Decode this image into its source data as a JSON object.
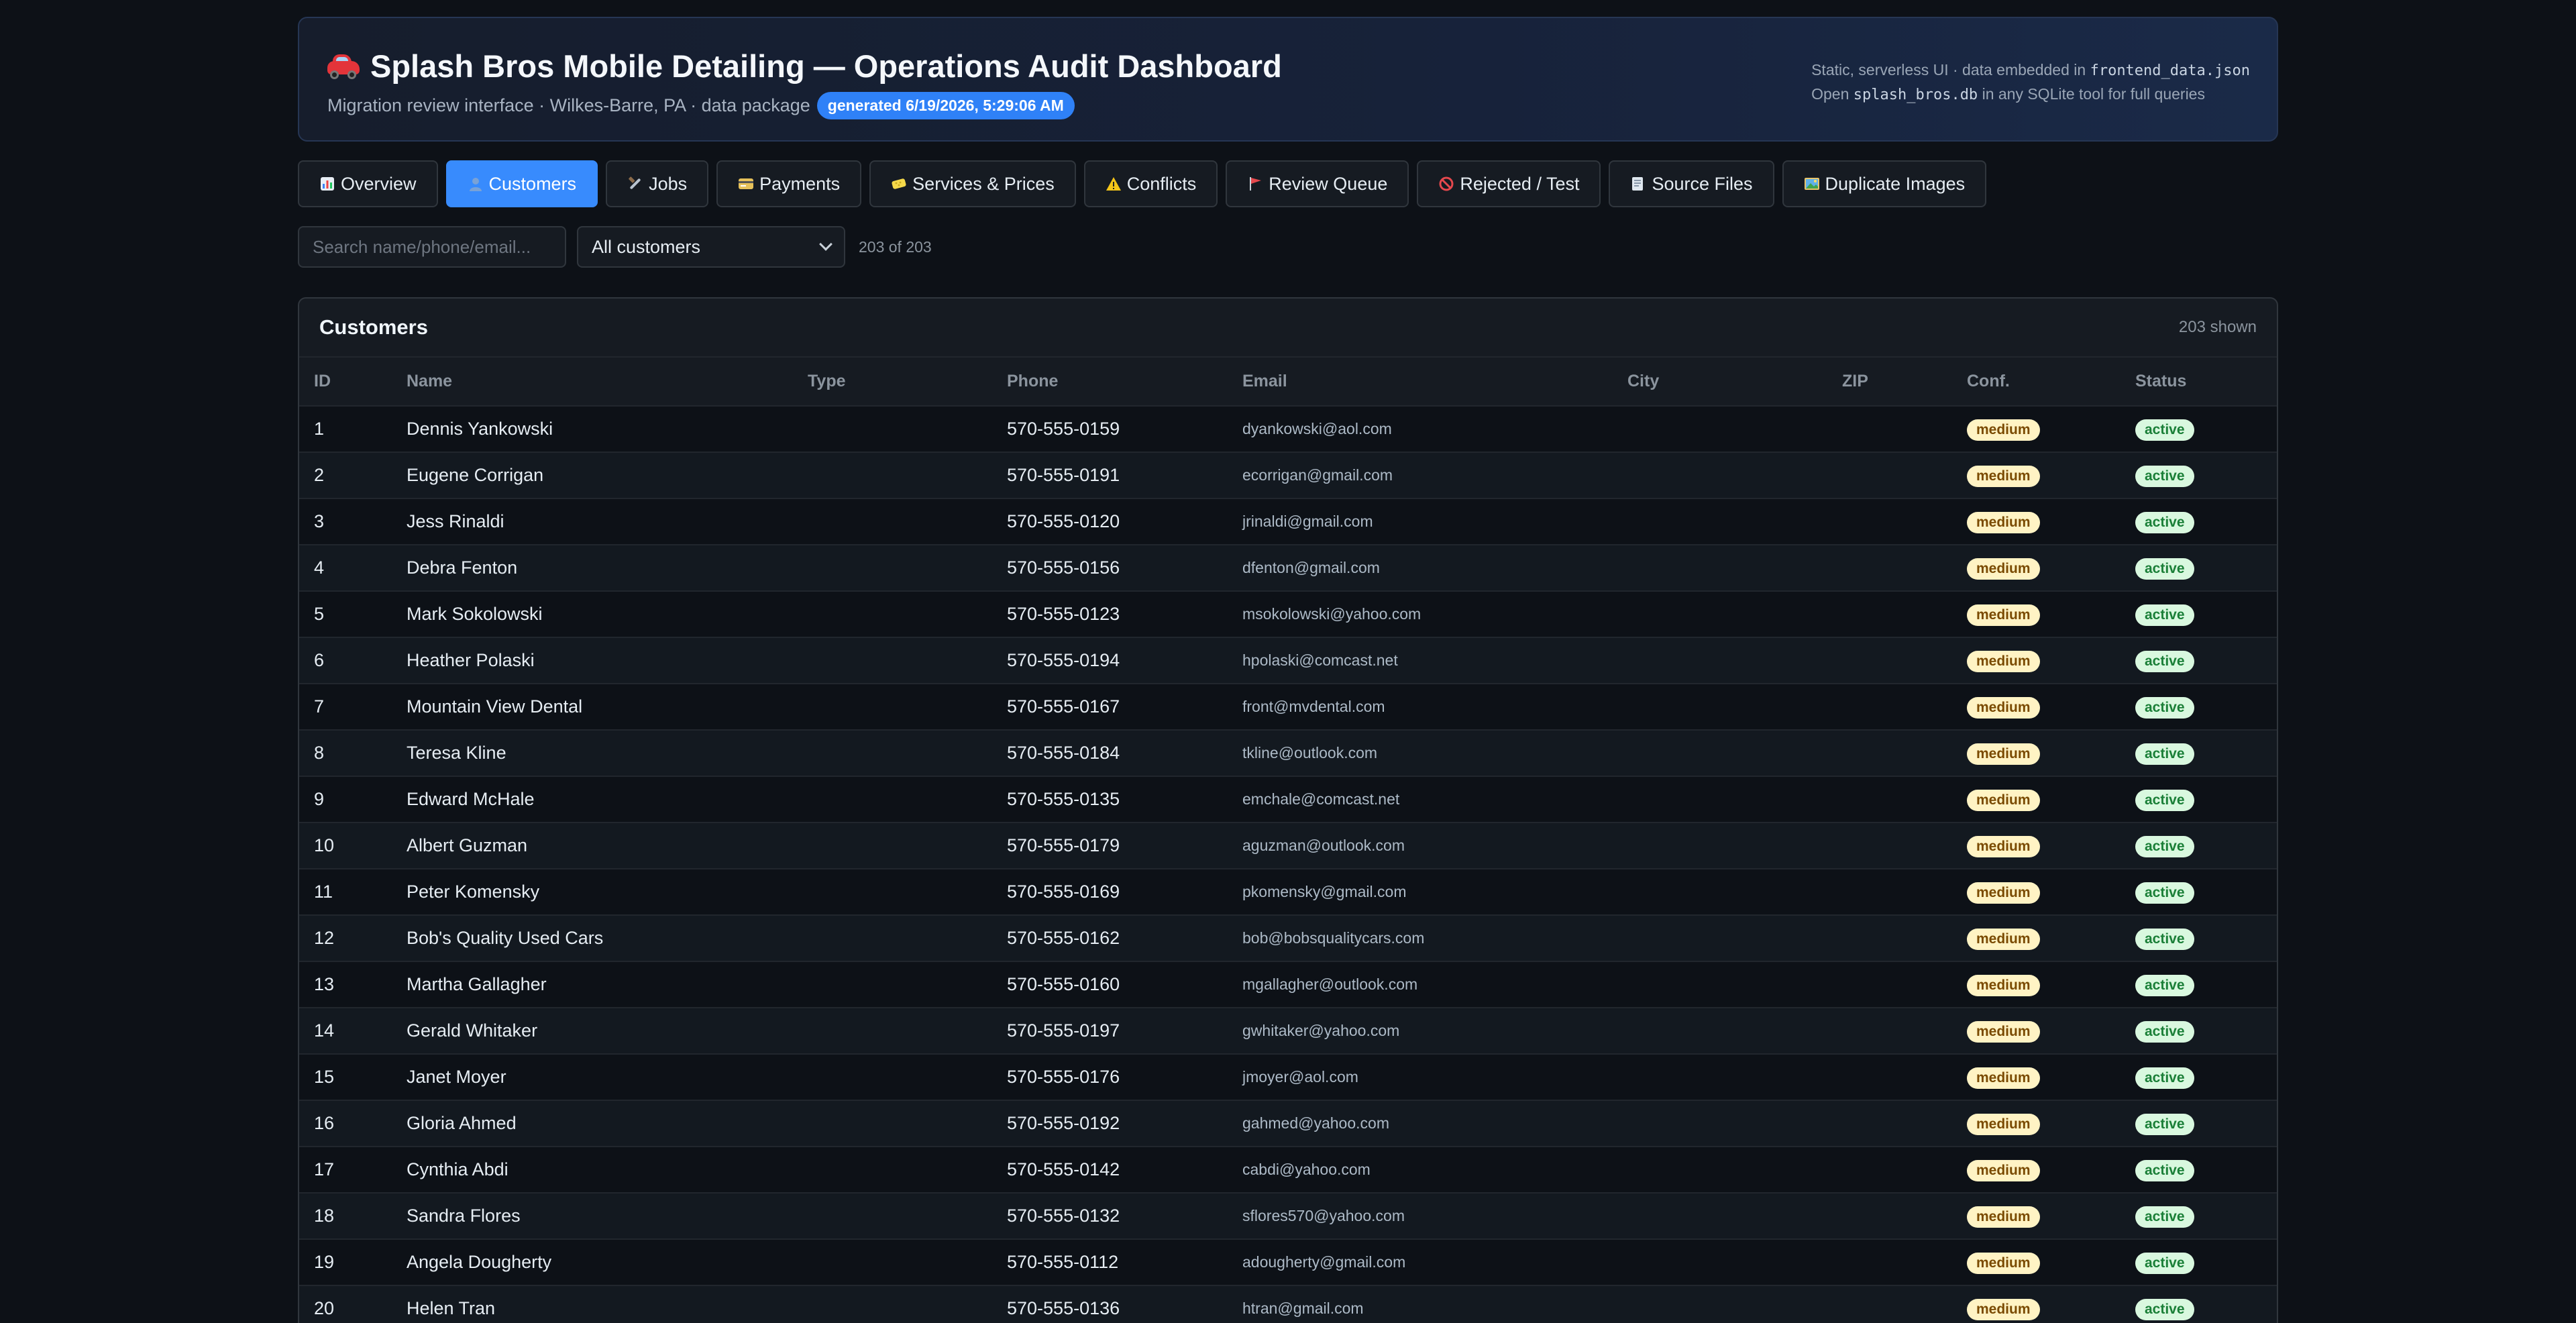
{
  "header": {
    "title": "Splash Bros Mobile Detailing — Operations Audit Dashboard",
    "subtitle": "Migration review interface · Wilkes-Barre, PA · data package",
    "generated": "generated 6/19/2026, 5:29:06 AM",
    "note_line1_prefix": "Static, serverless UI · data embedded in",
    "note_line1_code": "frontend_data.json",
    "note_line2_prefix": "Open",
    "note_line2_code": "splash_bros.db",
    "note_line2_suffix": "in any SQLite tool for full queries",
    "icon": "car-icon"
  },
  "tabs": [
    {
      "id": "overview",
      "label": "Overview",
      "icon": "chart-icon"
    },
    {
      "id": "customers",
      "label": "Customers",
      "icon": "person-icon",
      "active": true
    },
    {
      "id": "jobs",
      "label": "Jobs",
      "icon": "wrench-icon"
    },
    {
      "id": "payments",
      "label": "Payments",
      "icon": "card-icon"
    },
    {
      "id": "services",
      "label": "Services & Prices",
      "icon": "sponge-icon"
    },
    {
      "id": "conflicts",
      "label": "Conflicts",
      "icon": "warning-icon"
    },
    {
      "id": "review",
      "label": "Review Queue",
      "icon": "flag-icon"
    },
    {
      "id": "rejected",
      "label": "Rejected / Test",
      "icon": "prohibited-icon"
    },
    {
      "id": "source",
      "label": "Source Files",
      "icon": "folder-icon"
    },
    {
      "id": "duplicates",
      "label": "Duplicate Images",
      "icon": "image-icon"
    }
  ],
  "filters": {
    "search_placeholder": "Search name/phone/email...",
    "select_value": "All customers",
    "count_text": "203 of 203"
  },
  "panel": {
    "title": "Customers",
    "count": "203 shown",
    "columns": [
      "ID",
      "Name",
      "Type",
      "Phone",
      "Email",
      "City",
      "ZIP",
      "Conf.",
      "Status"
    ],
    "rows": [
      {
        "id": "1",
        "name": "Dennis Yankowski",
        "type": "",
        "phone": "570-555-0159",
        "email": "dyankowski@aol.com",
        "city": "",
        "zip": "",
        "conf": "medium",
        "status": "active"
      },
      {
        "id": "2",
        "name": "Eugene Corrigan",
        "type": "",
        "phone": "570-555-0191",
        "email": "ecorrigan@gmail.com",
        "city": "",
        "zip": "",
        "conf": "medium",
        "status": "active"
      },
      {
        "id": "3",
        "name": "Jess Rinaldi",
        "type": "",
        "phone": "570-555-0120",
        "email": "jrinaldi@gmail.com",
        "city": "",
        "zip": "",
        "conf": "medium",
        "status": "active"
      },
      {
        "id": "4",
        "name": "Debra Fenton",
        "type": "",
        "phone": "570-555-0156",
        "email": "dfenton@gmail.com",
        "city": "",
        "zip": "",
        "conf": "medium",
        "status": "active"
      },
      {
        "id": "5",
        "name": "Mark Sokolowski",
        "type": "",
        "phone": "570-555-0123",
        "email": "msokolowski@yahoo.com",
        "city": "",
        "zip": "",
        "conf": "medium",
        "status": "active"
      },
      {
        "id": "6",
        "name": "Heather Polaski",
        "type": "",
        "phone": "570-555-0194",
        "email": "hpolaski@comcast.net",
        "city": "",
        "zip": "",
        "conf": "medium",
        "status": "active"
      },
      {
        "id": "7",
        "name": "Mountain View Dental",
        "type": "",
        "phone": "570-555-0167",
        "email": "front@mvdental.com",
        "city": "",
        "zip": "",
        "conf": "medium",
        "status": "active"
      },
      {
        "id": "8",
        "name": "Teresa Kline",
        "type": "",
        "phone": "570-555-0184",
        "email": "tkline@outlook.com",
        "city": "",
        "zip": "",
        "conf": "medium",
        "status": "active"
      },
      {
        "id": "9",
        "name": "Edward McHale",
        "type": "",
        "phone": "570-555-0135",
        "email": "emchale@comcast.net",
        "city": "",
        "zip": "",
        "conf": "medium",
        "status": "active"
      },
      {
        "id": "10",
        "name": "Albert Guzman",
        "type": "",
        "phone": "570-555-0179",
        "email": "aguzman@outlook.com",
        "city": "",
        "zip": "",
        "conf": "medium",
        "status": "active"
      },
      {
        "id": "11",
        "name": "Peter Komensky",
        "type": "",
        "phone": "570-555-0169",
        "email": "pkomensky@gmail.com",
        "city": "",
        "zip": "",
        "conf": "medium",
        "status": "active"
      },
      {
        "id": "12",
        "name": "Bob's Quality Used Cars",
        "type": "",
        "phone": "570-555-0162",
        "email": "bob@bobsqualitycars.com",
        "city": "",
        "zip": "",
        "conf": "medium",
        "status": "active"
      },
      {
        "id": "13",
        "name": "Martha Gallagher",
        "type": "",
        "phone": "570-555-0160",
        "email": "mgallagher@outlook.com",
        "city": "",
        "zip": "",
        "conf": "medium",
        "status": "active"
      },
      {
        "id": "14",
        "name": "Gerald Whitaker",
        "type": "",
        "phone": "570-555-0197",
        "email": "gwhitaker@yahoo.com",
        "city": "",
        "zip": "",
        "conf": "medium",
        "status": "active"
      },
      {
        "id": "15",
        "name": "Janet Moyer",
        "type": "",
        "phone": "570-555-0176",
        "email": "jmoyer@aol.com",
        "city": "",
        "zip": "",
        "conf": "medium",
        "status": "active"
      },
      {
        "id": "16",
        "name": "Gloria Ahmed",
        "type": "",
        "phone": "570-555-0192",
        "email": "gahmed@yahoo.com",
        "city": "",
        "zip": "",
        "conf": "medium",
        "status": "active"
      },
      {
        "id": "17",
        "name": "Cynthia Abdi",
        "type": "",
        "phone": "570-555-0142",
        "email": "cabdi@yahoo.com",
        "city": "",
        "zip": "",
        "conf": "medium",
        "status": "active"
      },
      {
        "id": "18",
        "name": "Sandra Flores",
        "type": "",
        "phone": "570-555-0132",
        "email": "sflores570@yahoo.com",
        "city": "",
        "zip": "",
        "conf": "medium",
        "status": "active"
      },
      {
        "id": "19",
        "name": "Angela Dougherty",
        "type": "",
        "phone": "570-555-0112",
        "email": "adougherty@gmail.com",
        "city": "",
        "zip": "",
        "conf": "medium",
        "status": "active"
      },
      {
        "id": "20",
        "name": "Helen Tran",
        "type": "",
        "phone": "570-555-0136",
        "email": "htran@gmail.com",
        "city": "",
        "zip": "",
        "conf": "medium",
        "status": "active"
      }
    ]
  },
  "colors": {
    "background": "#0d1117",
    "accent": "#388bfd",
    "conf_badge": "#fff3c4",
    "status_badge": "#d9f8df"
  }
}
